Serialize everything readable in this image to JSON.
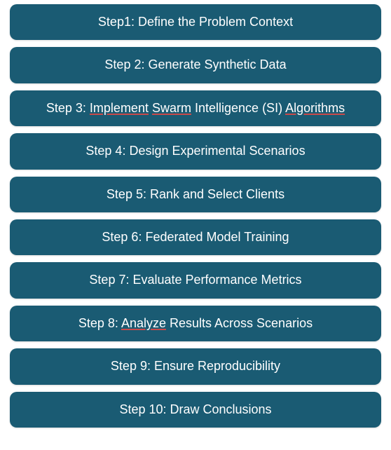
{
  "steps": [
    {
      "label": "Step1: Define the Problem Context",
      "underlines": []
    },
    {
      "label": "Step 2: Generate Synthetic Data",
      "underlines": []
    },
    {
      "label": "Step 3: Implement Swarm Intelligence (SI) Algorithms",
      "underlines": [
        "Implement",
        "Swarm",
        "Algorithms"
      ]
    },
    {
      "label": "Step 4: Design Experimental Scenarios",
      "underlines": []
    },
    {
      "label": "Step 5: Rank and Select Clients",
      "underlines": []
    },
    {
      "label": "Step 6: Federated Model Training",
      "underlines": []
    },
    {
      "label": "Step 7: Evaluate Performance Metrics",
      "underlines": []
    },
    {
      "label": "Step 8: Analyze Results Across Scenarios",
      "underlines": [
        "Analyze"
      ]
    },
    {
      "label": "Step 9: Ensure Reproducibility",
      "underlines": []
    },
    {
      "label": "Step 10: Draw Conclusions",
      "underlines": []
    }
  ],
  "colors": {
    "box_bg": "#1a5b73",
    "text": "#ffffff",
    "underline": "#c94a4a"
  }
}
